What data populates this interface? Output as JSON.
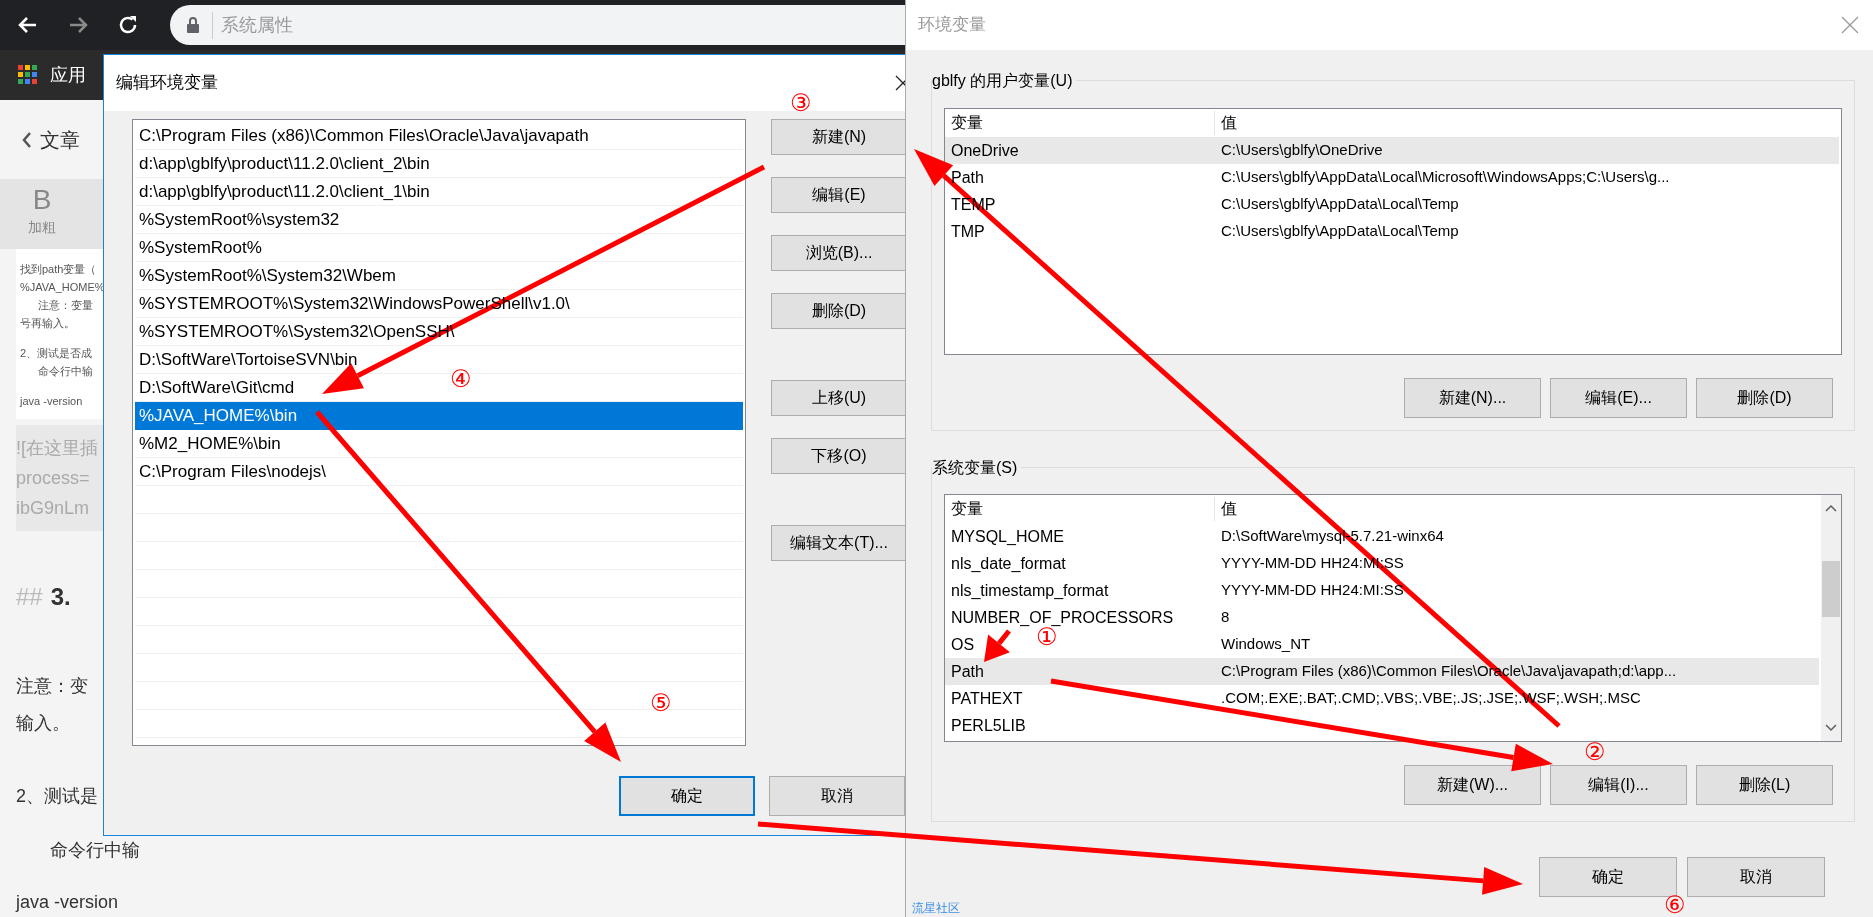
{
  "browser": {
    "address": "系统属性",
    "bookmark": "应用"
  },
  "page": {
    "back_link": "文章",
    "toolbar": [
      {
        "glyph": "B",
        "label": "加粗"
      }
    ],
    "preview_lines": [
      "找到path变量（",
      "%JAVA_HOME%",
      "注意：变量",
      "号再输入。",
      "2、测试是否成",
      "命令行中输",
      "java -version"
    ],
    "code_lines": [
      "![在这里插",
      "process=",
      "ibG9nLm"
    ],
    "heading_marker": "##",
    "heading": "3.",
    "paragraphs": [
      "注意：变",
      "输入。",
      "2、测试是",
      "命令行中输"
    ],
    "code_line": "java -version"
  },
  "edit_dialog": {
    "title": "编辑环境变量",
    "entries": [
      {
        "text": "C:\\Program Files (x86)\\Common Files\\Oracle\\Java\\javapath",
        "selected": false
      },
      {
        "text": "d:\\app\\gblfy\\product\\11.2.0\\client_2\\bin",
        "selected": false
      },
      {
        "text": "d:\\app\\gblfy\\product\\11.2.0\\client_1\\bin",
        "selected": false
      },
      {
        "text": "%SystemRoot%\\system32",
        "selected": false
      },
      {
        "text": "%SystemRoot%",
        "selected": false
      },
      {
        "text": "%SystemRoot%\\System32\\Wbem",
        "selected": false
      },
      {
        "text": "%SYSTEMROOT%\\System32\\WindowsPowerShell\\v1.0\\",
        "selected": false
      },
      {
        "text": "%SYSTEMROOT%\\System32\\OpenSSH\\",
        "selected": false
      },
      {
        "text": "D:\\SoftWare\\TortoiseSVN\\bin",
        "selected": false
      },
      {
        "text": "D:\\SoftWare\\Git\\cmd",
        "selected": false
      },
      {
        "text": "%JAVA_HOME%\\bin",
        "selected": true
      },
      {
        "text": "%M2_HOME%\\bin",
        "selected": false
      },
      {
        "text": "C:\\Program Files\\nodejs\\",
        "selected": false
      }
    ],
    "side_buttons": [
      "新建(N)",
      "编辑(E)",
      "浏览(B)...",
      "删除(D)",
      "上移(U)",
      "下移(O)",
      "编辑文本(T)..."
    ],
    "buttons": [
      {
        "label": "确定",
        "default": true
      },
      {
        "label": "取消",
        "default": false
      }
    ]
  },
  "env_window": {
    "title": "环境变量",
    "user_group": {
      "label": "gblfy 的用户变量(U)",
      "columns": [
        "变量",
        "值"
      ],
      "rows": [
        {
          "name": "OneDrive",
          "value": "C:\\Users\\gblfy\\OneDrive",
          "selected": true
        },
        {
          "name": "Path",
          "value": "C:\\Users\\gblfy\\AppData\\Local\\Microsoft\\WindowsApps;C:\\Users\\g...",
          "selected": false
        },
        {
          "name": "TEMP",
          "value": "C:\\Users\\gblfy\\AppData\\Local\\Temp",
          "selected": false
        },
        {
          "name": "TMP",
          "value": "C:\\Users\\gblfy\\AppData\\Local\\Temp",
          "selected": false
        }
      ],
      "buttons": [
        "新建(N)...",
        "编辑(E)...",
        "删除(D)"
      ]
    },
    "system_group": {
      "label": "系统变量(S)",
      "columns": [
        "变量",
        "值"
      ],
      "rows": [
        {
          "name": "MYSQL_HOME",
          "value": "D:\\SoftWare\\mysql-5.7.21-winx64",
          "selected": false
        },
        {
          "name": "nls_date_format",
          "value": "YYYY-MM-DD HH24:MI:SS",
          "selected": false
        },
        {
          "name": "nls_timestamp_format",
          "value": "YYYY-MM-DD HH24:MI:SS",
          "selected": false
        },
        {
          "name": "NUMBER_OF_PROCESSORS",
          "value": "8",
          "selected": false
        },
        {
          "name": "OS",
          "value": "Windows_NT",
          "selected": false
        },
        {
          "name": "Path",
          "value": "C:\\Program Files (x86)\\Common Files\\Oracle\\Java\\javapath;d:\\app...",
          "selected": true
        },
        {
          "name": "PATHEXT",
          "value": ".COM;.EXE;.BAT;.CMD;.VBS;.VBE;.JS;.JSE;.WSF;.WSH;.MSC",
          "selected": false
        },
        {
          "name": "PERL5LIB",
          "value": "",
          "selected": false
        }
      ],
      "buttons": [
        "新建(W)...",
        "编辑(I)...",
        "删除(L)"
      ]
    },
    "buttons": [
      "确定",
      "取消"
    ],
    "footer_link": "流星社区"
  },
  "annotations": [
    {
      "label": "③"
    },
    {
      "label": "④"
    },
    {
      "label": "⑤"
    },
    {
      "label": "①"
    },
    {
      "label": "②"
    },
    {
      "label": "⑥"
    }
  ]
}
